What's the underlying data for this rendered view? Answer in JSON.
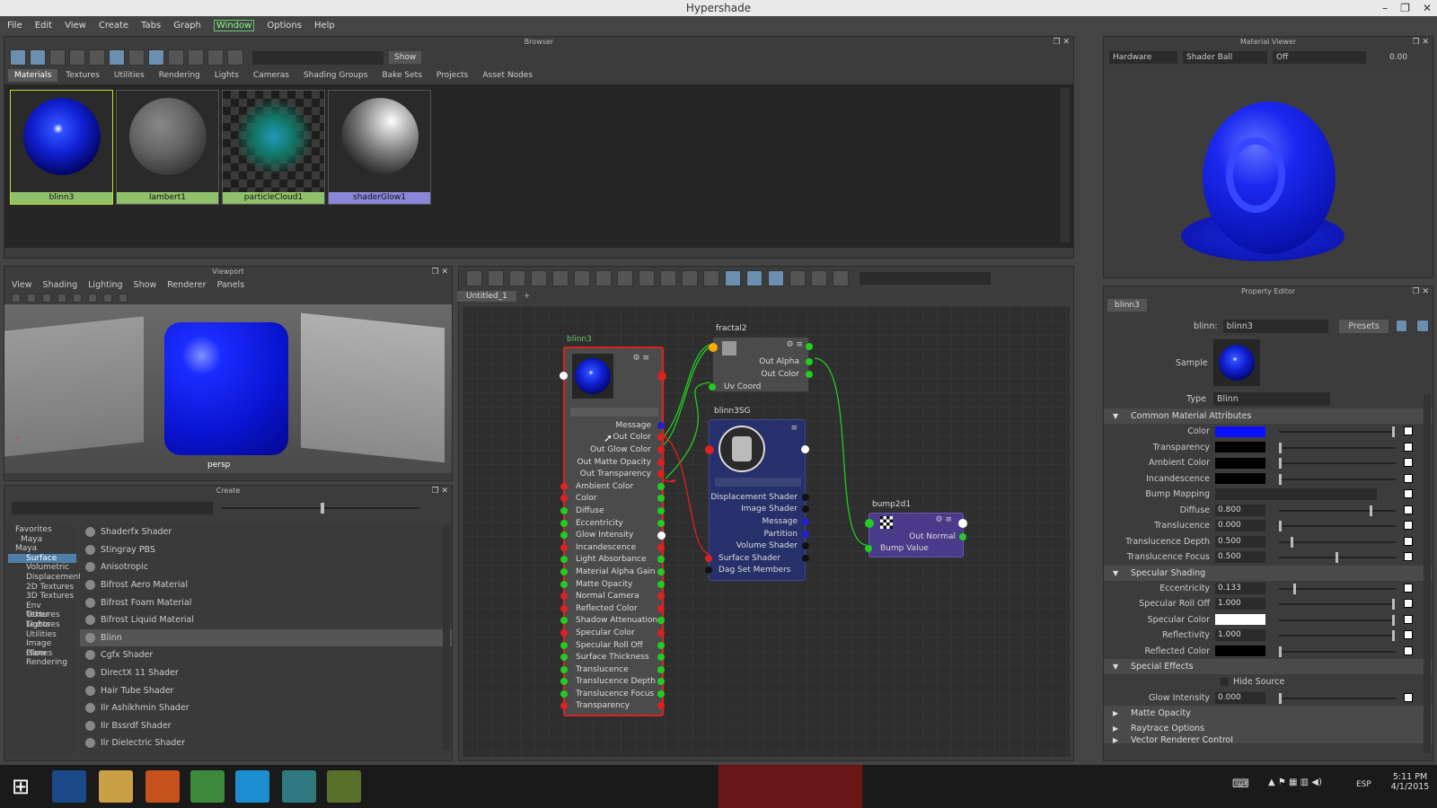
{
  "window": {
    "title": "Hypershade"
  },
  "menu": [
    "File",
    "Edit",
    "View",
    "Create",
    "Tabs",
    "Graph",
    "Window",
    "Options",
    "Help"
  ],
  "menu_active": "Window",
  "browser": {
    "title": "Browser",
    "show_button": "Show",
    "tabs": [
      "Materials",
      "Textures",
      "Utilities",
      "Rendering",
      "Lights",
      "Cameras",
      "Shading Groups",
      "Bake Sets",
      "Projects",
      "Asset Nodes"
    ],
    "selected_tab": "Materials",
    "swatches": [
      {
        "name": "blinn3",
        "color": "#1428e6",
        "label_bg": "#8fc06a"
      },
      {
        "name": "lambert1",
        "color": "#777777",
        "label_bg": "#8fc06a"
      },
      {
        "name": "particleCloud1",
        "color": "#1aa0a0",
        "label_bg": "#8fc06a"
      },
      {
        "name": "shaderGlow1",
        "color": "#dddddd",
        "label_bg": "#8c86d9"
      }
    ]
  },
  "material_viewer": {
    "title": "Material Viewer",
    "renderer": "Hardware",
    "shape": "Shader Ball",
    "env": "Off",
    "exposure": "0.00"
  },
  "viewport": {
    "title": "Viewport",
    "menu": [
      "View",
      "Shading",
      "Lighting",
      "Show",
      "Renderer",
      "Panels"
    ],
    "camera_label": "persp"
  },
  "create": {
    "title": "Create",
    "tree": [
      "Favorites",
      "Maya",
      "Maya",
      "Surface",
      "Volumetric",
      "Displacement",
      "2D Textures",
      "3D Textures",
      "Env Textures",
      "Other Textures",
      "Lights",
      "Utilities",
      "Image Planes",
      "Glow",
      "Rendering"
    ],
    "tree_selected": "Surface",
    "items": [
      "Shaderfx Shader",
      "Stingray PBS",
      "Anisotropic",
      "Bifrost Aero Material",
      "Bifrost Foam Material",
      "Bifrost Liquid Material",
      "Blinn",
      "Cgfx Shader",
      "DirectX 11 Shader",
      "Hair Tube Shader",
      "Ilr Ashikhmin Shader",
      "Ilr Bssrdf Shader",
      "Ilr Dielectric Shader"
    ],
    "selected_item": "Blinn"
  },
  "graph": {
    "tab": "Untitled_1",
    "add_tab": "+",
    "nodes": {
      "blinn3": {
        "title": "blinn3",
        "outputs": [
          "Message",
          "Out Color",
          "Out Glow Color",
          "Out Matte Opacity",
          "Out Transparency"
        ],
        "inputs": [
          "Ambient Color",
          "Color",
          "Diffuse",
          "Eccentricity",
          "Glow Intensity",
          "Incandescence",
          "Light Absorbance",
          "Material Alpha Gain",
          "Matte Opacity",
          "Normal Camera",
          "Reflected Color",
          "Shadow Attenuation",
          "Specular Color",
          "Specular Roll Off",
          "Surface Thickness",
          "Translucence",
          "Translucence Depth",
          "Translucence Focus",
          "Transparency"
        ]
      },
      "fractal2": {
        "title": "fractal2",
        "outputs": [
          "Out Alpha",
          "Out Color"
        ],
        "inputs": [
          "Uv Coord"
        ]
      },
      "blinn3SG": {
        "title": "blinn3SG",
        "attrs": [
          "Displacement Shader",
          "Image Shader",
          "Message",
          "Partition",
          "Volume Shader",
          "Surface Shader",
          "Dag Set Members"
        ]
      },
      "bump2d1": {
        "title": "bump2d1",
        "outputs": [
          "Out Normal"
        ],
        "inputs": [
          "Bump Value"
        ]
      }
    }
  },
  "property_editor": {
    "title": "Property Editor",
    "tab": "blinn3",
    "node_label": "blinn:",
    "node_name": "blinn3",
    "presets": "Presets",
    "sample_label": "Sample",
    "type_label": "Type",
    "type_value": "Blinn",
    "sections": {
      "common": "Common Material Attributes",
      "specular": "Specular Shading",
      "special": "Special Effects",
      "matte": "Matte Opacity",
      "raytrace": "Raytrace Options",
      "vector": "Vector Renderer Control"
    },
    "common_attrs": [
      {
        "label": "Color",
        "type": "color",
        "color": "#0a10ff",
        "slider": 1.0
      },
      {
        "label": "Transparency",
        "type": "color",
        "color": "#000000",
        "slider": 0.0
      },
      {
        "label": "Ambient Color",
        "type": "color",
        "color": "#000000",
        "slider": 0.0
      },
      {
        "label": "Incandescence",
        "type": "color",
        "color": "#000000",
        "slider": 0.0
      },
      {
        "label": "Bump Mapping",
        "type": "map"
      },
      {
        "label": "Diffuse",
        "type": "num",
        "value": "0.800",
        "slider": 0.8
      },
      {
        "label": "Translucence",
        "type": "num",
        "value": "0.000",
        "slider": 0.0
      },
      {
        "label": "Translucence Depth",
        "type": "num",
        "value": "0.500",
        "slider": 0.1
      },
      {
        "label": "Translucence Focus",
        "type": "num",
        "value": "0.500",
        "slider": 0.5
      }
    ],
    "specular_attrs": [
      {
        "label": "Eccentricity",
        "type": "num",
        "value": "0.133",
        "slider": 0.13
      },
      {
        "label": "Specular Roll Off",
        "type": "num",
        "value": "1.000",
        "slider": 1.0
      },
      {
        "label": "Specular Color",
        "type": "color",
        "color": "#ffffff",
        "slider": 1.0
      },
      {
        "label": "Reflectivity",
        "type": "num",
        "value": "1.000",
        "slider": 1.0
      },
      {
        "label": "Reflected Color",
        "type": "color",
        "color": "#000000",
        "slider": 0.0
      }
    ],
    "special": {
      "hide_source": "Hide Source",
      "glow_label": "Glow Intensity",
      "glow_value": "0.000",
      "glow_slider": 0.0
    }
  },
  "taskbar": {
    "lang": "ESP",
    "time": "5:11 PM",
    "date": "4/1/2015"
  }
}
